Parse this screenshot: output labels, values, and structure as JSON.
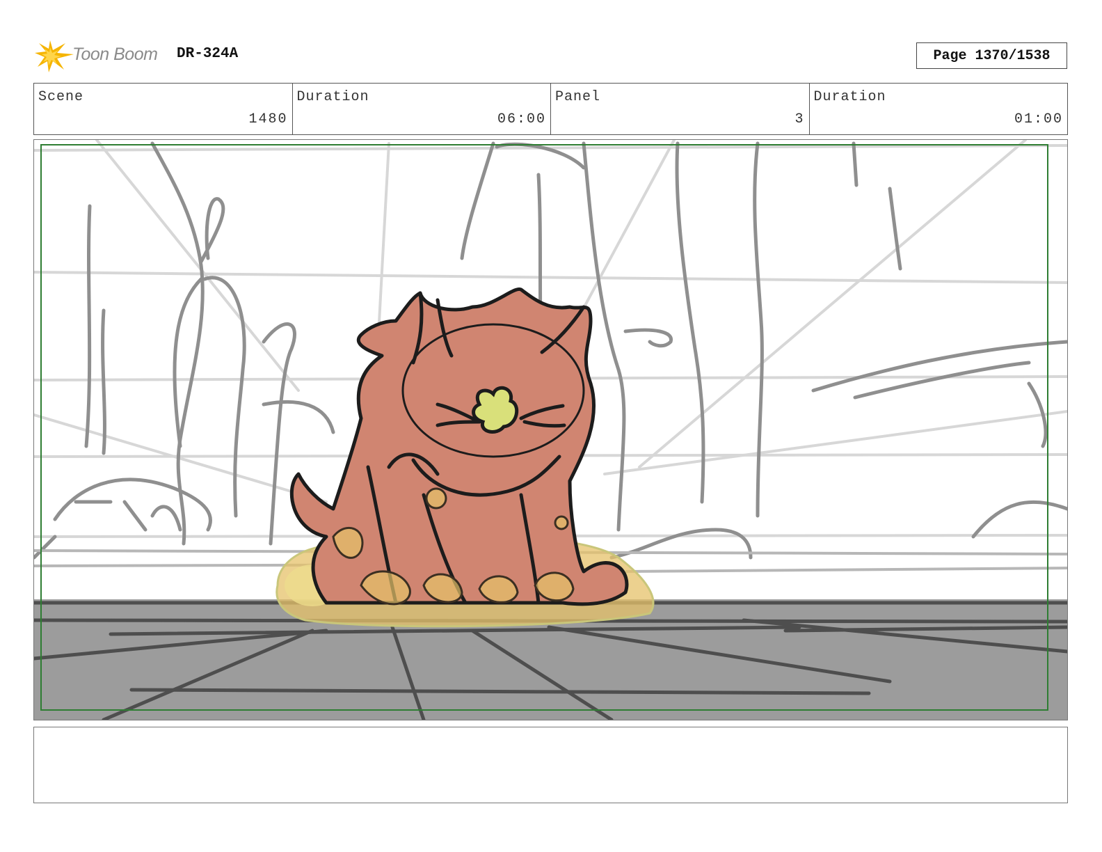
{
  "header": {
    "brand": "Toon Boom",
    "project_code": "DR-324A",
    "page_label": "Page 1370/1538"
  },
  "info": {
    "scene_label": "Scene",
    "scene_value": "1480",
    "scene_duration_label": "Duration",
    "scene_duration_value": "06:00",
    "panel_label": "Panel",
    "panel_value": "3",
    "panel_duration_label": "Duration",
    "panel_duration_value": "01:00"
  },
  "colors": {
    "safe_frame": "#2e7d32",
    "character_fill": "#d08571",
    "floor": "#9c9c9c",
    "puddle": "#e6c26a",
    "nose": "#d9e07a",
    "logo_star": "#f5b400"
  },
  "notes": {
    "text": ""
  }
}
